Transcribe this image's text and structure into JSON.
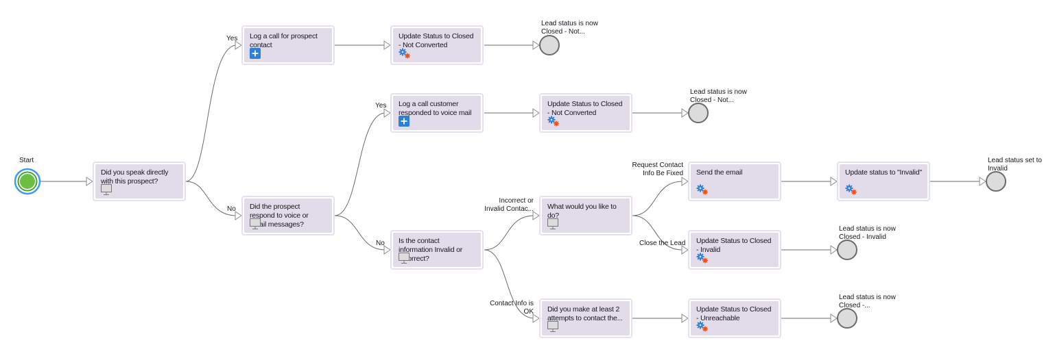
{
  "start": {
    "label": "Start",
    "colors": {
      "outer": "#3d9be9",
      "ring": "#4aa52e",
      "fill": "#6dbe45"
    }
  },
  "nodes": [
    {
      "id": "n1",
      "label": "Did you speak directly with this prospect?",
      "type": "screen"
    },
    {
      "id": "n2",
      "label": "Log a call for prospect contact",
      "type": "create"
    },
    {
      "id": "n3",
      "label": "Update Status to Closed - Not Converted",
      "type": "action"
    },
    {
      "id": "n4",
      "label": "Did the prospect respond to voice or email messages?",
      "type": "screen"
    },
    {
      "id": "n5",
      "label": "Log a call customer responded to voice mail",
      "type": "create"
    },
    {
      "id": "n6",
      "label": "Update Status to Closed - Not Converted",
      "type": "action"
    },
    {
      "id": "n7",
      "label": "Is the contact information Invalid or Incorrect?",
      "type": "screen"
    },
    {
      "id": "n8",
      "label": "What would you like to do?",
      "type": "screen"
    },
    {
      "id": "n9",
      "label": "Send the email",
      "type": "action"
    },
    {
      "id": "n10",
      "label": "Update status to \"Invalid\"",
      "type": "action"
    },
    {
      "id": "n11",
      "label": "Update Status to Closed - Invalid",
      "type": "action"
    },
    {
      "id": "n12",
      "label": "Did you make at least 2 attempts to contact the...",
      "type": "screen"
    },
    {
      "id": "n13",
      "label": "Update Status to Closed - Unreachable",
      "type": "action"
    }
  ],
  "ends": [
    {
      "id": "e1",
      "label": "Lead status is now Closed - Not..."
    },
    {
      "id": "e2",
      "label": "Lead status is now Closed - Not..."
    },
    {
      "id": "e3",
      "label": "Lead status set to Invalid"
    },
    {
      "id": "e4",
      "label": "Lead status is now Closed - Invalid"
    },
    {
      "id": "e5",
      "label": "Lead status is now Closed -..."
    }
  ],
  "edge_labels": {
    "yes1": "Yes",
    "no1": "No",
    "yes2": "Yes",
    "no2": "No",
    "incorrect": "Incorrect or Invalid Contac...",
    "ok": "Contact Info is OK",
    "request": "Request Contact Info Be Fixed",
    "close": "Close the Lead"
  },
  "colors": {
    "node_fill": "#e2dcea",
    "node_border": "#e6e1ee",
    "connector": "#6b6b6b",
    "end_fill": "#dcdcdc",
    "end_stroke": "#6b6b6b",
    "create_icon": "#2f7fd8",
    "gear_blue": "#2f7fd8",
    "gear_orange": "#f0521d"
  }
}
